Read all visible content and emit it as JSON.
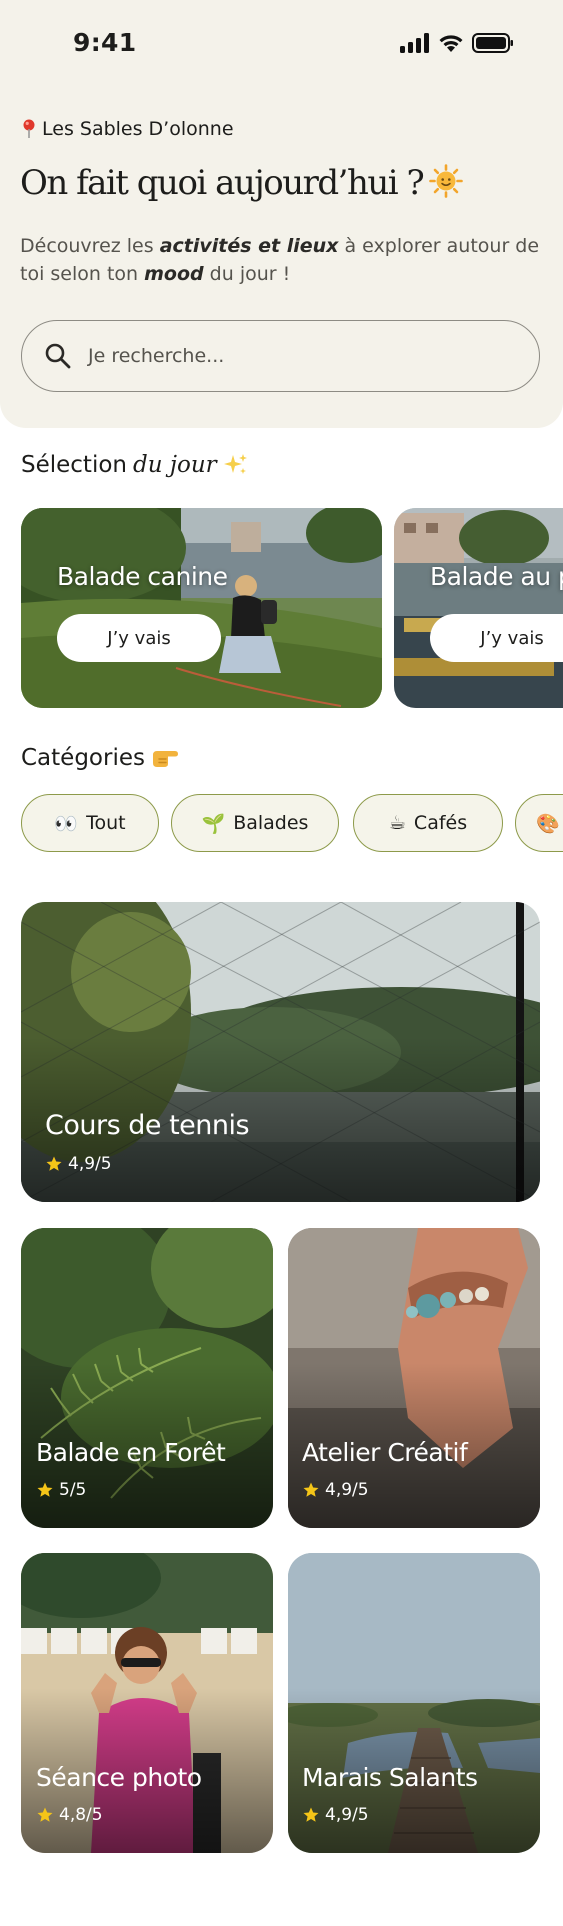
{
  "status_bar": {
    "time": "9:41"
  },
  "location": {
    "name": "Les Sables D’olonne"
  },
  "hero": {
    "title": "On fait quoi aujourd’hui ?",
    "intro_1": "Découvrez les ",
    "intro_bold_1": "activités et lieux",
    "intro_2": " à explorer autour de toi selon ton ",
    "intro_bold_2": "mood",
    "intro_3": " du jour !"
  },
  "search": {
    "placeholder": "Je recherche..."
  },
  "selection": {
    "title_prefix": "Sélection ",
    "title_italic": "du jour",
    "cards": [
      {
        "title": "Balade canine",
        "button": "J’y vais"
      },
      {
        "title": "Balade au port",
        "button": "J’y vais"
      }
    ]
  },
  "categories": {
    "title": "Catégories",
    "chips": [
      {
        "emoji": "👀",
        "label": "Tout"
      },
      {
        "emoji": "🌱",
        "label": "Balades"
      },
      {
        "emoji": "☕",
        "label": "Cafés"
      },
      {
        "emoji": "🎨",
        "label": ""
      }
    ]
  },
  "places": [
    {
      "title": "Cours de tennis",
      "rating": "4,9/5"
    },
    {
      "title": "Balade en Forêt",
      "rating": "5/5"
    },
    {
      "title": "Atelier Créatif",
      "rating": "4,9/5"
    },
    {
      "title": "Séance photo",
      "rating": "4,8/5"
    },
    {
      "title": "Marais Salants",
      "rating": "4,9/5"
    }
  ],
  "colors": {
    "background_panel": "#f4f2ea",
    "chip_border": "#8d9a4a",
    "star": "#f5c518"
  }
}
